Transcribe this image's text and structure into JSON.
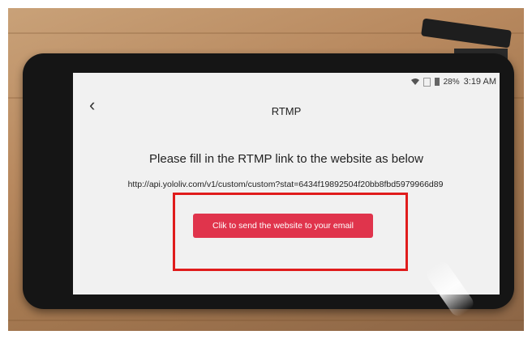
{
  "status_bar": {
    "battery_percent": "28%",
    "time": "3:19 AM",
    "wifi_icon": "wifi-icon",
    "sim_icon": "sim-icon",
    "battery_icon": "battery-icon"
  },
  "header": {
    "back_icon": "chevron-left-icon",
    "title": "RTMP"
  },
  "main": {
    "instruction": "Please fill in the RTMP link to the website as below",
    "rtmp_url": "http://api.yololiv.com/v1/custom/custom?stat=6434f19892504f20bb8fbd5979966d89",
    "send_button_label": "Clik to send the website to your email"
  },
  "colors": {
    "accent": "#e0344c",
    "highlight": "#e01c1c"
  }
}
